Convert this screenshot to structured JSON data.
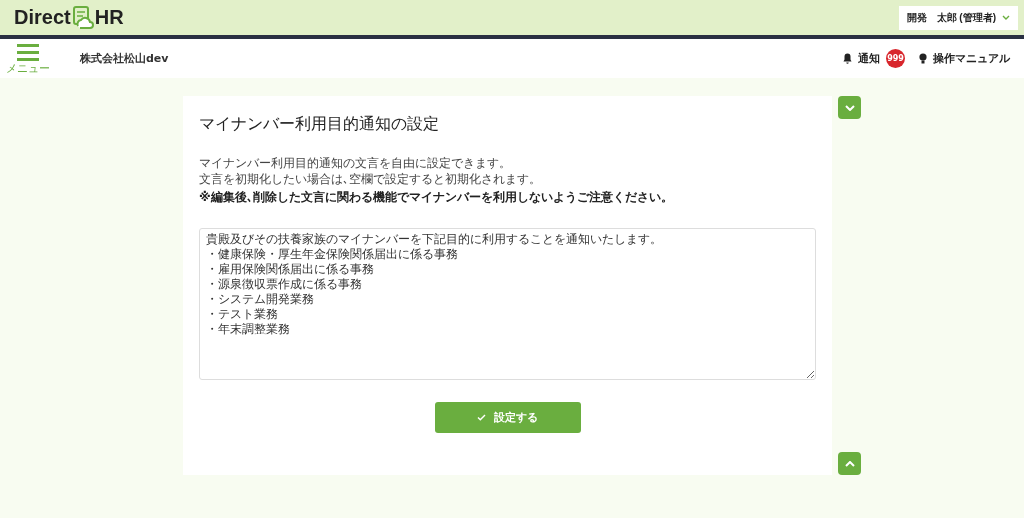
{
  "header": {
    "logo_left": "Direct",
    "logo_right": "HR",
    "user_menu": "開発　太郎 (管理者)"
  },
  "nav": {
    "menu_label": "メニュー",
    "company": "株式会社松山dev",
    "notifications": {
      "label": "通知",
      "count": "999"
    },
    "manual": "操作マニュアル"
  },
  "page": {
    "title": "マイナンバー利用目的通知の設定",
    "description": [
      "マイナンバー利用目的通知の文言を自由に設定できます。",
      "文言を初期化したい場合は､空欄で設定すると初期化されます。"
    ],
    "warning": "※編集後､削除した文言に関わる機能でマイナンバーを利用しないようご注意ください。",
    "notice_text": [
      "貴殿及びその扶養家族のマイナンバーを下記目的に利用することを通知いたします。",
      "・健康保険・厚生年金保険関係届出に係る事務",
      "・雇用保険関係届出に係る事務",
      "・源泉徴収票作成に係る事務",
      "・システム開発業務",
      "・テスト業務",
      "・年末調整業務"
    ],
    "submit_button": "設定する"
  }
}
